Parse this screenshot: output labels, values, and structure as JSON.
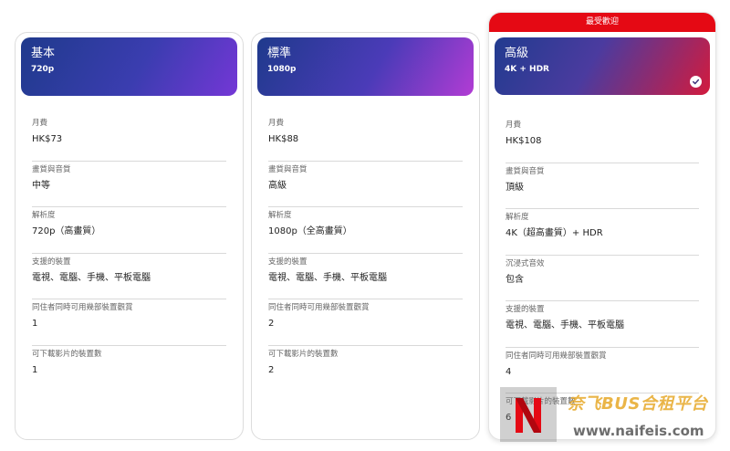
{
  "plans": [
    {
      "name": "基本",
      "resolution": "720p",
      "details": [
        {
          "label": "月費",
          "value": "HK$73"
        },
        {
          "label": "畫質與音質",
          "value": "中等"
        },
        {
          "label": "解析度",
          "value": "720p（高畫質）"
        },
        {
          "label": "支援的裝置",
          "value": "電視、電腦、手機、平板電腦"
        },
        {
          "label": "同住者同時可用幾部裝置觀賞",
          "value": "1"
        },
        {
          "label": "可下載影片的裝置數",
          "value": "1"
        }
      ]
    },
    {
      "name": "標準",
      "resolution": "1080p",
      "details": [
        {
          "label": "月費",
          "value": "HK$88"
        },
        {
          "label": "畫質與音質",
          "value": "高級"
        },
        {
          "label": "解析度",
          "value": "1080p（全高畫質）"
        },
        {
          "label": "支援的裝置",
          "value": "電視、電腦、手機、平板電腦"
        },
        {
          "label": "同住者同時可用幾部裝置觀賞",
          "value": "2"
        },
        {
          "label": "可下載影片的裝置數",
          "value": "2"
        }
      ]
    },
    {
      "name": "高級",
      "resolution": "4K + HDR",
      "badge": "最受歡迎",
      "selected": true,
      "details": [
        {
          "label": "月費",
          "value": "HK$108"
        },
        {
          "label": "畫質與音質",
          "value": "頂級"
        },
        {
          "label": "解析度",
          "value": "4K（超高畫質）+ HDR"
        },
        {
          "label": "沉浸式音效",
          "value": "包含"
        },
        {
          "label": "支援的裝置",
          "value": "電視、電腦、手機、平板電腦"
        },
        {
          "label": "同住者同時可用幾部裝置觀賞",
          "value": "4"
        },
        {
          "label": "可下載影片的裝置數",
          "value": "6"
        }
      ]
    }
  ],
  "watermark": {
    "text1": "奈飞BUS合租平台",
    "text2": "www.naifeis.com"
  },
  "colors": {
    "accent": "#e50914",
    "header_start": "#1f3a8c",
    "header_end_basic": "#7437d6",
    "header_end_standard": "#b23cd4",
    "header_end_premium": "#d21b3e"
  },
  "icons": {
    "selected": "check-circle-icon",
    "watermark_logo": "netflix-n-logo"
  }
}
